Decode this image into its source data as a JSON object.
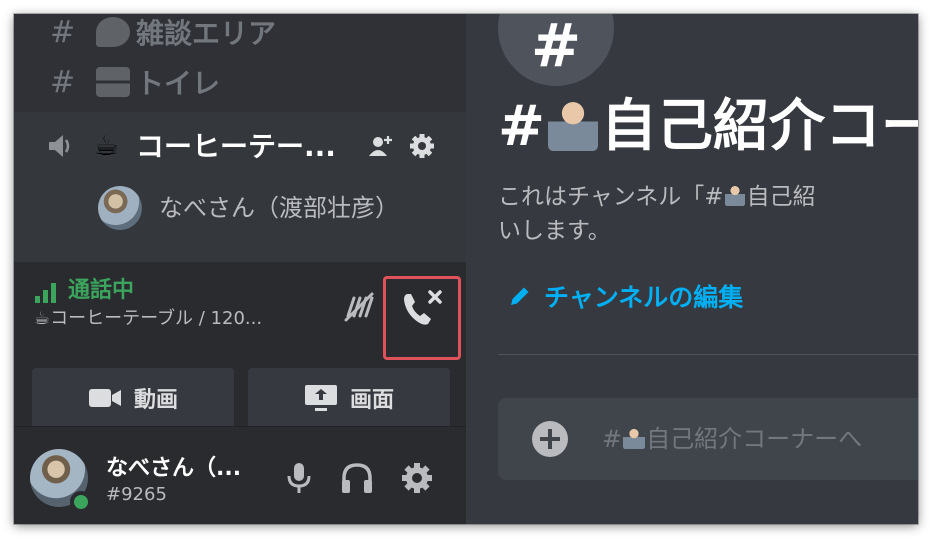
{
  "sidebar": {
    "channels": [
      {
        "hash": "#",
        "name": "雑談エリア",
        "emoji": "speech-bubble-icon"
      },
      {
        "hash": "#",
        "name": "トイレ",
        "emoji": "toilet-icon"
      }
    ],
    "voice_channel": {
      "emoji": "☕",
      "name": "コーヒーテー...",
      "member": {
        "name": "なべさん（渡部壮彦）"
      }
    },
    "call": {
      "status": "通話中",
      "channel": "☕コーヒーテーブル / 120...",
      "video_label": "動画",
      "screen_label": "画面"
    },
    "user": {
      "name": "なべさん（...",
      "tag": "#9265",
      "status_color": "#3ba55d"
    }
  },
  "main": {
    "hash_symbol": "#",
    "title_prefix": "#",
    "title_text": "自己紹介コー",
    "description_part1": "これはチャンネル「#",
    "description_part2": "自己紹",
    "description_line2": "いします。",
    "edit_label": "チャンネルの編集",
    "message_prefix": "#",
    "message_text": "自己紹介コーナーへ"
  },
  "colors": {
    "accent_green": "#3ba55d",
    "link_blue": "#00aff4",
    "highlight_red": "#e0525a"
  }
}
